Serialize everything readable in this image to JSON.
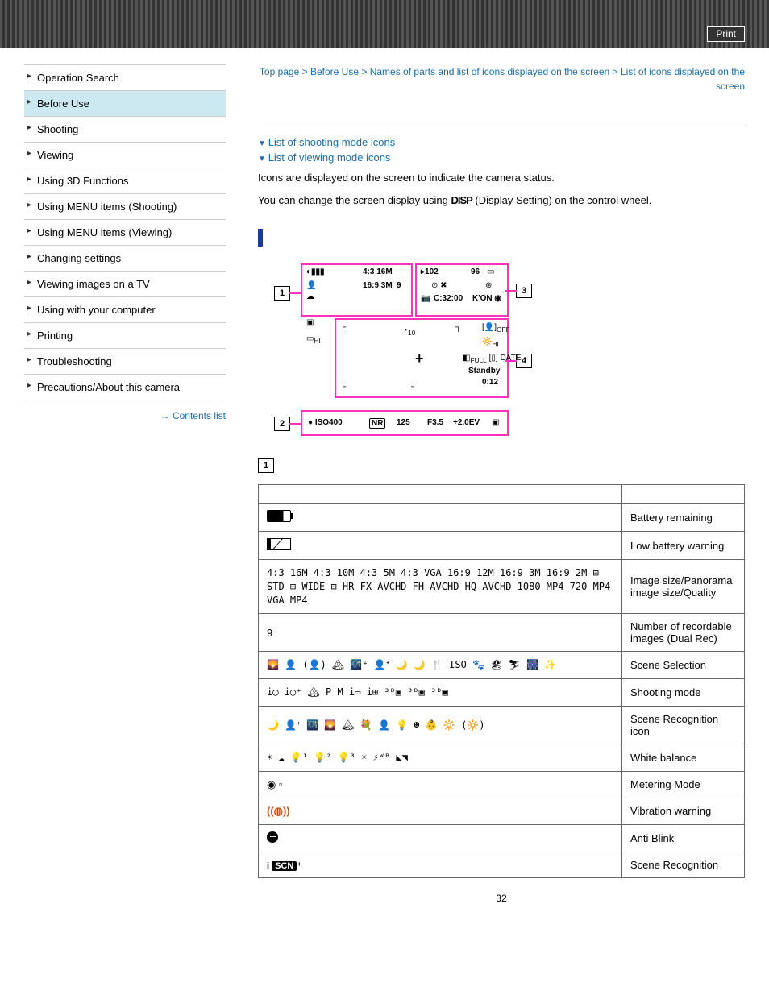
{
  "top": {
    "print": "Print"
  },
  "sidebar": {
    "items": [
      "Operation Search",
      "Before Use",
      "Shooting",
      "Viewing",
      "Using 3D Functions",
      "Using MENU items (Shooting)",
      "Using MENU items (Viewing)",
      "Changing settings",
      "Viewing images on a TV",
      "Using with your computer",
      "Printing",
      "Troubleshooting",
      "Precautions/About this camera"
    ],
    "active_index": 1,
    "contents_list": "Contents list"
  },
  "breadcrumb": {
    "a": "Top page",
    "sep": " > ",
    "b": "Before Use",
    "c": "Names of parts and list of icons displayed on the screen",
    "d": "List of icons displayed on the screen"
  },
  "anchors": {
    "a1": "List of shooting mode icons",
    "a2": "List of viewing mode icons"
  },
  "intro": {
    "l1": "Icons are displayed on the screen to indicate the camera status.",
    "l2a": "You can change the screen display using ",
    "disp": "DISP",
    "l2b": " (Display Setting) on the control wheel."
  },
  "diagram": {
    "n1": "1",
    "n2": "2",
    "n3": "3",
    "n4": "4",
    "t_16m": "4:3 16M",
    "t_3m": "16:9 3M",
    "t_9": "9",
    "t_102": "102",
    "t_96": "96",
    "t_c32": "C:32:00",
    "t_kon": "K'ON",
    "t_hi": "HI",
    "t_10": "10",
    "t_off": "OFF",
    "t_hi2": "HI",
    "t_full": "FULL",
    "t_date": "DATE",
    "t_standby": "Standby",
    "t_time": "0:12",
    "t_iso": "ISO400",
    "t_nr": "NR",
    "t_125": "125",
    "t_f35": "F3.5",
    "t_ev": "+2.0EV"
  },
  "section_num": "1",
  "table": {
    "rows": [
      {
        "icon": "battery",
        "label": "Battery remaining"
      },
      {
        "icon": "low-battery",
        "label": "Low battery warning"
      },
      {
        "icon": "image-size",
        "label": "Image size/Panorama image size/Quality",
        "text": "4:3 16M 4:3 10M 4:3 5M 4:3 VGA 16:9 12M 16:9 3M 16:9 2M ⊟ STD ⊟ WIDE ⊟ HR FX AVCHD FH AVCHD HQ AVCHD 1080 MP4 720 MP4 VGA MP4"
      },
      {
        "icon": "number",
        "label": "Number of recordable images (Dual Rec)",
        "text": "9"
      },
      {
        "icon": "scene-selection",
        "label": "Scene Selection",
        "text": "🌄 👤 (👤) 🏔 🌃⁺ 👤ᐩ 🌙 🌙 🍴 ISO 🐾 🏖 ⛷ 🎆 ✨"
      },
      {
        "icon": "shooting-mode",
        "label": "Shooting mode",
        "text": "i◯ i◯⁺ 🏔 P M i▭ i⊞ ³ᴰ▣ ³ᴰ▣ ³ᴰ▣"
      },
      {
        "icon": "scene-recognition-icon",
        "label": "Scene Recognition icon",
        "text": "🌙 👤ᐩ 🌃 🌄 🏔 💐 👤 💡 ☻ 👶 🔆 (🔆)"
      },
      {
        "icon": "white-balance",
        "label": "White balance",
        "text": "☀ ☁ 💡¹ 💡² 💡³ ☀ ⚡ᵂᴮ ◣◥"
      },
      {
        "icon": "metering",
        "label": "Metering Mode"
      },
      {
        "icon": "vibration",
        "label": "Vibration warning"
      },
      {
        "icon": "anti-blink",
        "label": "Anti Blink"
      },
      {
        "icon": "scene-recognition",
        "label": "Scene Recognition"
      }
    ]
  },
  "page_number": "32"
}
